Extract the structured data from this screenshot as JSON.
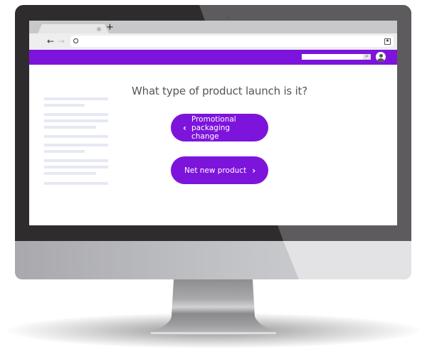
{
  "browser": {
    "new_tab_glyph": "+",
    "back_glyph": "←",
    "forward_glyph": "→",
    "bookmark_glyph": "★",
    "search_glyph": "⌕"
  },
  "site": {
    "header_color": "#7d14dc",
    "search": {
      "value": "",
      "placeholder": ""
    }
  },
  "content": {
    "placeholder_line_count": 12,
    "question": "What type of product launch is it?",
    "choices": [
      {
        "label": "Promotional packaging change",
        "direction": "back",
        "icon": "chevron-left-icon",
        "glyph": "‹"
      },
      {
        "label": "Net new product",
        "direction": "forward",
        "icon": "chevron-right-icon",
        "glyph": "›"
      }
    ]
  },
  "colors": {
    "accent": "#7d14dc",
    "question_text": "#555555",
    "button_text": "#ffffff",
    "placeholder_line": "#e6e9f4",
    "bezel": "#2e2c2d"
  }
}
